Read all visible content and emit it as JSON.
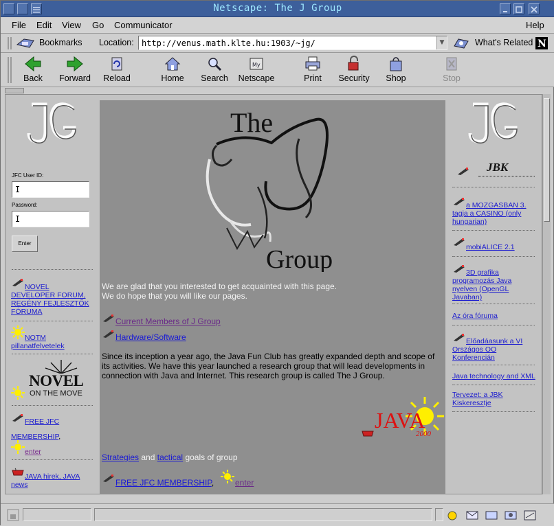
{
  "window": {
    "title": "Netscape: The J Group"
  },
  "menu": [
    "File",
    "Edit",
    "View",
    "Go",
    "Communicator",
    "Help"
  ],
  "locationbar": {
    "bookmarks_label": "Bookmarks",
    "location_label": "Location:",
    "url": "http://venus.math.klte.hu:1903/~jg/",
    "whats_related": "What's Related"
  },
  "toolbar": {
    "back": "Back",
    "forward": "Forward",
    "reload": "Reload",
    "home": "Home",
    "search": "Search",
    "netscape": "Netscape",
    "print": "Print",
    "security": "Security",
    "shop": "Shop",
    "stop": "Stop"
  },
  "left": {
    "userid_label": "JFC User ID:",
    "password_label": "Password:",
    "enter_button": "Enter",
    "novel_forum": "NOVEL DEVELOPER FORUM, REGÉNY FEJLESZTŐK FÓRUMA",
    "notm": "NOTM pillanatfelvetelek",
    "novel_logo_top": "NOVEL",
    "novel_logo_bottom": "ON THE MOVE",
    "free_jfc": "FREE JFC",
    "membership": "MEMBERSHIP",
    "comma": ",",
    "enter_link": "enter",
    "java_hirek": "JAVA hirek, JAVA news"
  },
  "center": {
    "logo_the": "The",
    "logo_group": "Group",
    "intro_line1": "We are glad that you interested to get acquainted with this page.",
    "intro_line2": "We do hope that you will like our pages.",
    "link_members": "Current Members of J Group",
    "link_hardware": "Hardware/Software",
    "paragraph": "Since its inception a year ago, the Java Fun Club has greatly expanded depth and scope of its activities. We have this year launched a research group that will lead developments in connection with Java and Internet. This research group is called The J Group.",
    "java_logo": "JAVA",
    "java_year": "2000",
    "strategies": "Strategies",
    "and": "and",
    "tactical": "tactical",
    "goals": "goals of group",
    "free_jfc_membership": "FREE JFC MEMBERSHIP",
    "comma": ",",
    "enter_link": "enter"
  },
  "right": {
    "jbk_logo": "JBK",
    "mozgasban": "a MOZGASBAN 3. tagja a CASINO (only hungarian)",
    "mobialice": "mobiALICE 2.1",
    "grafika": "3D grafika programozás Java nyelven (OpenGL Javaban)",
    "ora_foruma": "Az óra fóruma",
    "eloadas": "Előadáasunk a VI Országos OO Konferencián",
    "java_tech": "Java technology and XML",
    "tervezet": "Tervezet: a JBK Kiskeresztje"
  }
}
